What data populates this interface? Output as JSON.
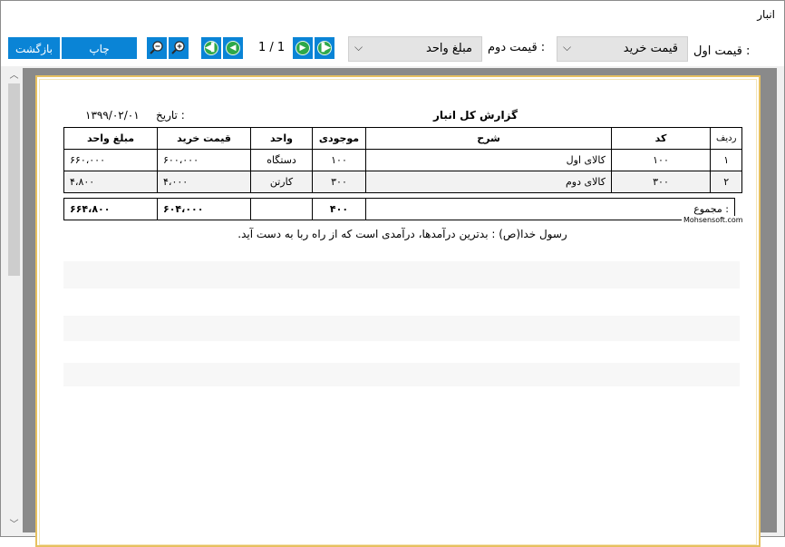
{
  "window": {
    "title": "انبار"
  },
  "toolbar": {
    "back_label": "بازگشت",
    "print_label": "چاپ",
    "page_indicator": "1 / 1",
    "second_price_label": "قیمت دوم :",
    "second_price_value": "مبلغ واحد",
    "first_price_label": "قیمت اول :",
    "first_price_value": "قیمت خرید",
    "combo_arrow": "⌵",
    "zoom_out_icon": "zoom-out-icon",
    "zoom_in_icon": "zoom-in-icon",
    "nav_icons": [
      "last-page-icon",
      "next-page-icon",
      "previous-page-icon",
      "first-page-icon"
    ]
  },
  "report": {
    "title": "گزارش کل انبار",
    "date_label": "تاریخ :",
    "date_value": "۱۳۹۹/۰۲/۰۱",
    "columns": {
      "row": "ردیف",
      "code": "کد",
      "desc": "شرح",
      "stock": "موجودی",
      "unit": "واحد",
      "buy_price": "قیمت خرید",
      "unit_amount": "مبلغ واحد"
    },
    "rows": [
      {
        "row": "۱",
        "code": "۱۰۰",
        "desc": "کالای اول",
        "stock": "۱۰۰",
        "unit": "دستگاه",
        "buy_price": "۶۰۰،۰۰۰",
        "unit_amount": "۶۶۰،۰۰۰"
      },
      {
        "row": "۲",
        "code": "۳۰۰",
        "desc": "کالای دوم",
        "stock": "۳۰۰",
        "unit": "کارتن",
        "buy_price": "۴،۰۰۰",
        "unit_amount": "۴،۸۰۰"
      }
    ],
    "totals": {
      "label": "مجموع :",
      "stock": "۴۰۰",
      "unit": "",
      "buy_price": "۶۰۴،۰۰۰",
      "unit_amount": "۶۶۴،۸۰۰"
    },
    "site": "Mohsensoft.com",
    "hadith_line1": "رسول خدا(ص) : بدترین درآمدها، درآمدی است که از راه ربا به دست آید."
  },
  "colors": {
    "button_blue": "#0a84d6",
    "nav_green": "#2ea84a",
    "paper_border": "#e6c060"
  }
}
